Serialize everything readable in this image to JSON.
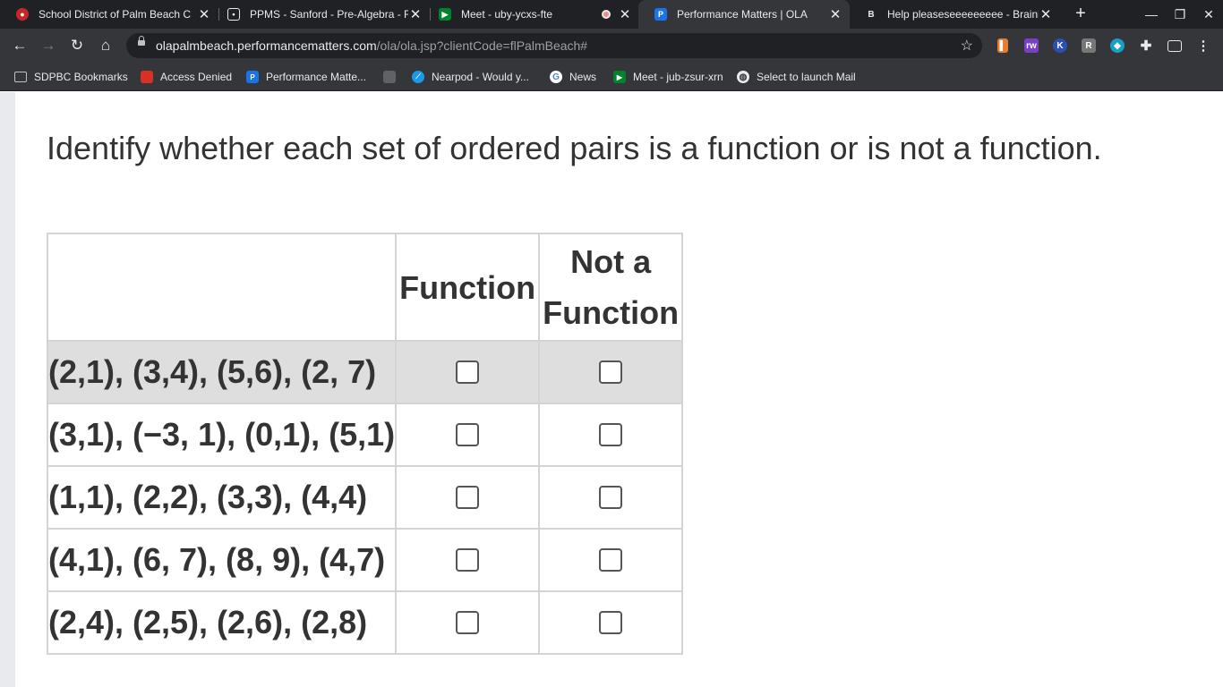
{
  "browser": {
    "tabs": [
      {
        "title": "School District of Palm Beach C",
        "favicon": "sdpbc-shield-icon",
        "color": "#c62828"
      },
      {
        "title": "PPMS - Sanford - Pre-Algebra - F",
        "favicon": "classroom-icon",
        "color": "#5f6368"
      },
      {
        "title": "Meet - uby-ycxs-fte",
        "favicon": "google-meet-icon",
        "color": "#00832d",
        "recording": true
      },
      {
        "title": "Performance Matters | OLA",
        "favicon": "performance-matters-icon",
        "color": "#1a73e8",
        "active": true
      },
      {
        "title": "Help pleaseseeeeeeeee - Brainly",
        "favicon": "brainly-icon",
        "color": "#202124"
      }
    ],
    "url_host": "olapalmbeach.performancematters.com",
    "url_path": "/ola/ola.jsp?clientCode=flPalmBeach#",
    "bookmarks": [
      {
        "label": "SDPBC Bookmarks",
        "icon": "folder-icon"
      },
      {
        "label": "Access Denied",
        "icon": "red-square-icon"
      },
      {
        "label": "Performance Matte...",
        "icon": "performance-matters-icon"
      },
      {
        "label": "",
        "icon": "gray-bookmark-icon"
      },
      {
        "label": "Nearpod - Would y...",
        "icon": "nearpod-icon"
      },
      {
        "label": "News",
        "icon": "google-icon"
      },
      {
        "label": "Meet - jub-zsur-xrn",
        "icon": "google-meet-icon"
      },
      {
        "label": "Select to launch Mail",
        "icon": "globe-icon"
      }
    ]
  },
  "question": {
    "prompt": "Identify whether each set of ordered pairs is a function or is not a function.",
    "columns": [
      "Function",
      "Not a Function"
    ],
    "rows": [
      {
        "pairs": "(2,1), (3,4), (5,6), (2, 7)",
        "highlighted": true
      },
      {
        "pairs": "(3,1), (−3, 1), (0,1), (5,1)"
      },
      {
        "pairs": "(1,1), (2,2), (3,3), (4,4)"
      },
      {
        "pairs": "(4,1), (6, 7), (8, 9), (4,7)"
      },
      {
        "pairs": "(2,4), (2,5), (2,6), (2,8)"
      }
    ]
  }
}
